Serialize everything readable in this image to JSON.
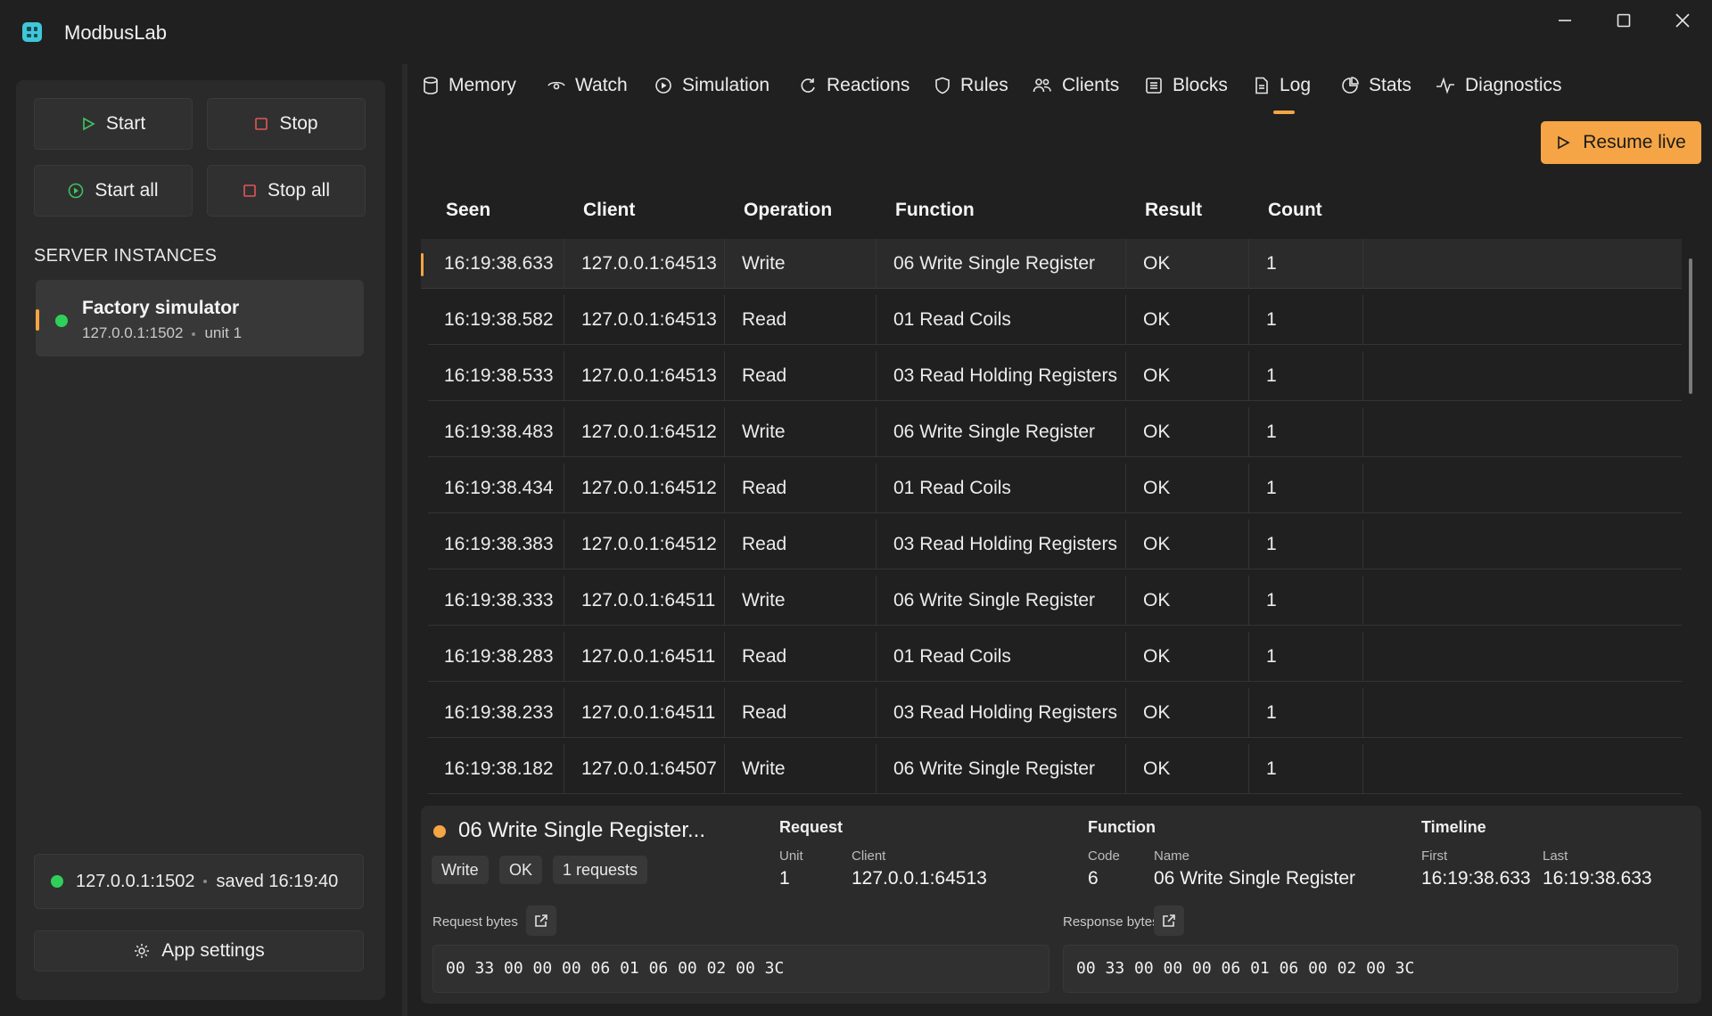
{
  "app": {
    "title": "ModbusLab"
  },
  "window_controls": [
    "minimize-icon",
    "maximize-icon",
    "close-icon"
  ],
  "colors": {
    "accent": "#f5a545",
    "online": "#2fd05a",
    "background": "#202020",
    "panel": "#2a2a2a"
  },
  "sidebar": {
    "buttons": {
      "start": "Start",
      "stop": "Stop",
      "start_all": "Start all",
      "stop_all": "Stop all"
    },
    "section_title": "SERVER INSTANCES",
    "instances": [
      {
        "name": "Factory simulator",
        "address": "127.0.0.1:1502",
        "unit": "unit 1",
        "status": "running"
      }
    ],
    "status": {
      "address": "127.0.0.1:1502",
      "saved": "saved 16:19:40"
    },
    "settings_label": "App settings"
  },
  "tabs": [
    {
      "label": "Memory",
      "icon": "database-icon"
    },
    {
      "label": "Watch",
      "icon": "eye-icon"
    },
    {
      "label": "Simulation",
      "icon": "play-circle-icon"
    },
    {
      "label": "Reactions",
      "icon": "refresh-icon"
    },
    {
      "label": "Rules",
      "icon": "shield-icon"
    },
    {
      "label": "Clients",
      "icon": "users-icon"
    },
    {
      "label": "Blocks",
      "icon": "list-box-icon"
    },
    {
      "label": "Log",
      "icon": "document-icon",
      "active": true
    },
    {
      "label": "Stats",
      "icon": "stats-icon"
    },
    {
      "label": "Diagnostics",
      "icon": "pulse-icon"
    }
  ],
  "log": {
    "resume_label": "Resume live",
    "columns": [
      "Seen",
      "Client",
      "Operation",
      "Function",
      "Result",
      "Count"
    ],
    "rows": [
      {
        "seen": "16:19:38.633",
        "client": "127.0.0.1:64513",
        "operation": "Write",
        "function": "06 Write Single Register",
        "result": "OK",
        "count": "1"
      },
      {
        "seen": "16:19:38.582",
        "client": "127.0.0.1:64513",
        "operation": "Read",
        "function": "01 Read Coils",
        "result": "OK",
        "count": "1"
      },
      {
        "seen": "16:19:38.533",
        "client": "127.0.0.1:64513",
        "operation": "Read",
        "function": "03 Read Holding Registers",
        "result": "OK",
        "count": "1"
      },
      {
        "seen": "16:19:38.483",
        "client": "127.0.0.1:64512",
        "operation": "Write",
        "function": "06 Write Single Register",
        "result": "OK",
        "count": "1"
      },
      {
        "seen": "16:19:38.434",
        "client": "127.0.0.1:64512",
        "operation": "Read",
        "function": "01 Read Coils",
        "result": "OK",
        "count": "1"
      },
      {
        "seen": "16:19:38.383",
        "client": "127.0.0.1:64512",
        "operation": "Read",
        "function": "03 Read Holding Registers",
        "result": "OK",
        "count": "1"
      },
      {
        "seen": "16:19:38.333",
        "client": "127.0.0.1:64511",
        "operation": "Write",
        "function": "06 Write Single Register",
        "result": "OK",
        "count": "1"
      },
      {
        "seen": "16:19:38.283",
        "client": "127.0.0.1:64511",
        "operation": "Read",
        "function": "01 Read Coils",
        "result": "OK",
        "count": "1"
      },
      {
        "seen": "16:19:38.233",
        "client": "127.0.0.1:64511",
        "operation": "Read",
        "function": "03 Read Holding Registers",
        "result": "OK",
        "count": "1"
      },
      {
        "seen": "16:19:38.182",
        "client": "127.0.0.1:64507",
        "operation": "Write",
        "function": "06 Write Single Register",
        "result": "OK",
        "count": "1"
      }
    ]
  },
  "detail": {
    "title": "06 Write Single Register...",
    "chips": [
      "Write",
      "OK",
      "1 requests"
    ],
    "request": {
      "heading": "Request",
      "unit_label": "Unit",
      "unit": "1",
      "client_label": "Client",
      "client": "127.0.0.1:64513"
    },
    "function": {
      "heading": "Function",
      "code_label": "Code",
      "code": "6",
      "name_label": "Name",
      "name": "06 Write Single Register"
    },
    "timeline": {
      "heading": "Timeline",
      "first_label": "First",
      "first": "16:19:38.633",
      "last_label": "Last",
      "last": "16:19:38.633"
    },
    "request_bytes_label": "Request bytes",
    "request_bytes": "00 33 00 00 00 06 01 06 00 02 00 3C",
    "response_bytes_label": "Response bytes",
    "response_bytes": "00 33 00 00 00 06 01 06 00 02 00 3C"
  }
}
